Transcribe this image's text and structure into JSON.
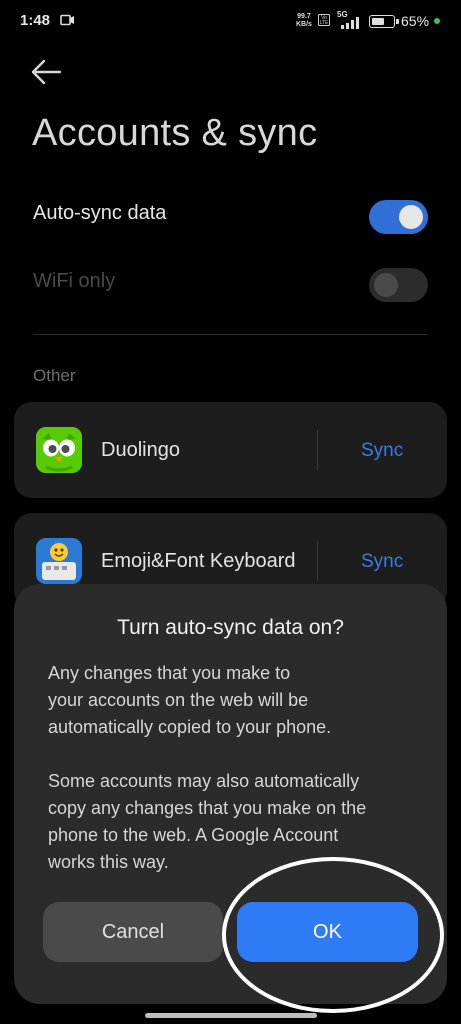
{
  "status_bar": {
    "time": "1:48",
    "net_speed_value": "99.7",
    "net_speed_unit": "KB/s",
    "volte": "Vo LTE",
    "network": "5G",
    "battery_percent": "65%",
    "battery_level": 0.65
  },
  "header": {
    "title": "Accounts & sync"
  },
  "settings": {
    "auto_sync": {
      "label": "Auto-sync data",
      "enabled": true
    },
    "wifi_only": {
      "label": "WiFi only",
      "enabled": false
    }
  },
  "section_other": "Other",
  "accounts": [
    {
      "name": "Duolingo",
      "action": "Sync",
      "icon": "duolingo-owl-icon"
    },
    {
      "name": "Emoji&Font Keyboard",
      "action": "Sync",
      "icon": "emoji-keyboard-icon"
    }
  ],
  "dialog": {
    "title": "Turn auto-sync data on?",
    "body_lines_1": [
      "Any changes that you make to",
      "your accounts on the web will be",
      "automatically copied to your phone."
    ],
    "body_lines_2": [
      "Some accounts may also automatically",
      "copy any changes that you make on the",
      "phone to the web. A Google Account",
      "works this way."
    ],
    "cancel_label": "Cancel",
    "ok_label": "OK"
  },
  "colors": {
    "accent": "#2f7bf5",
    "sync_link": "#3d7be5",
    "toggle_on": "#2f6fd6",
    "toggle_off": "#2c2c2c"
  }
}
